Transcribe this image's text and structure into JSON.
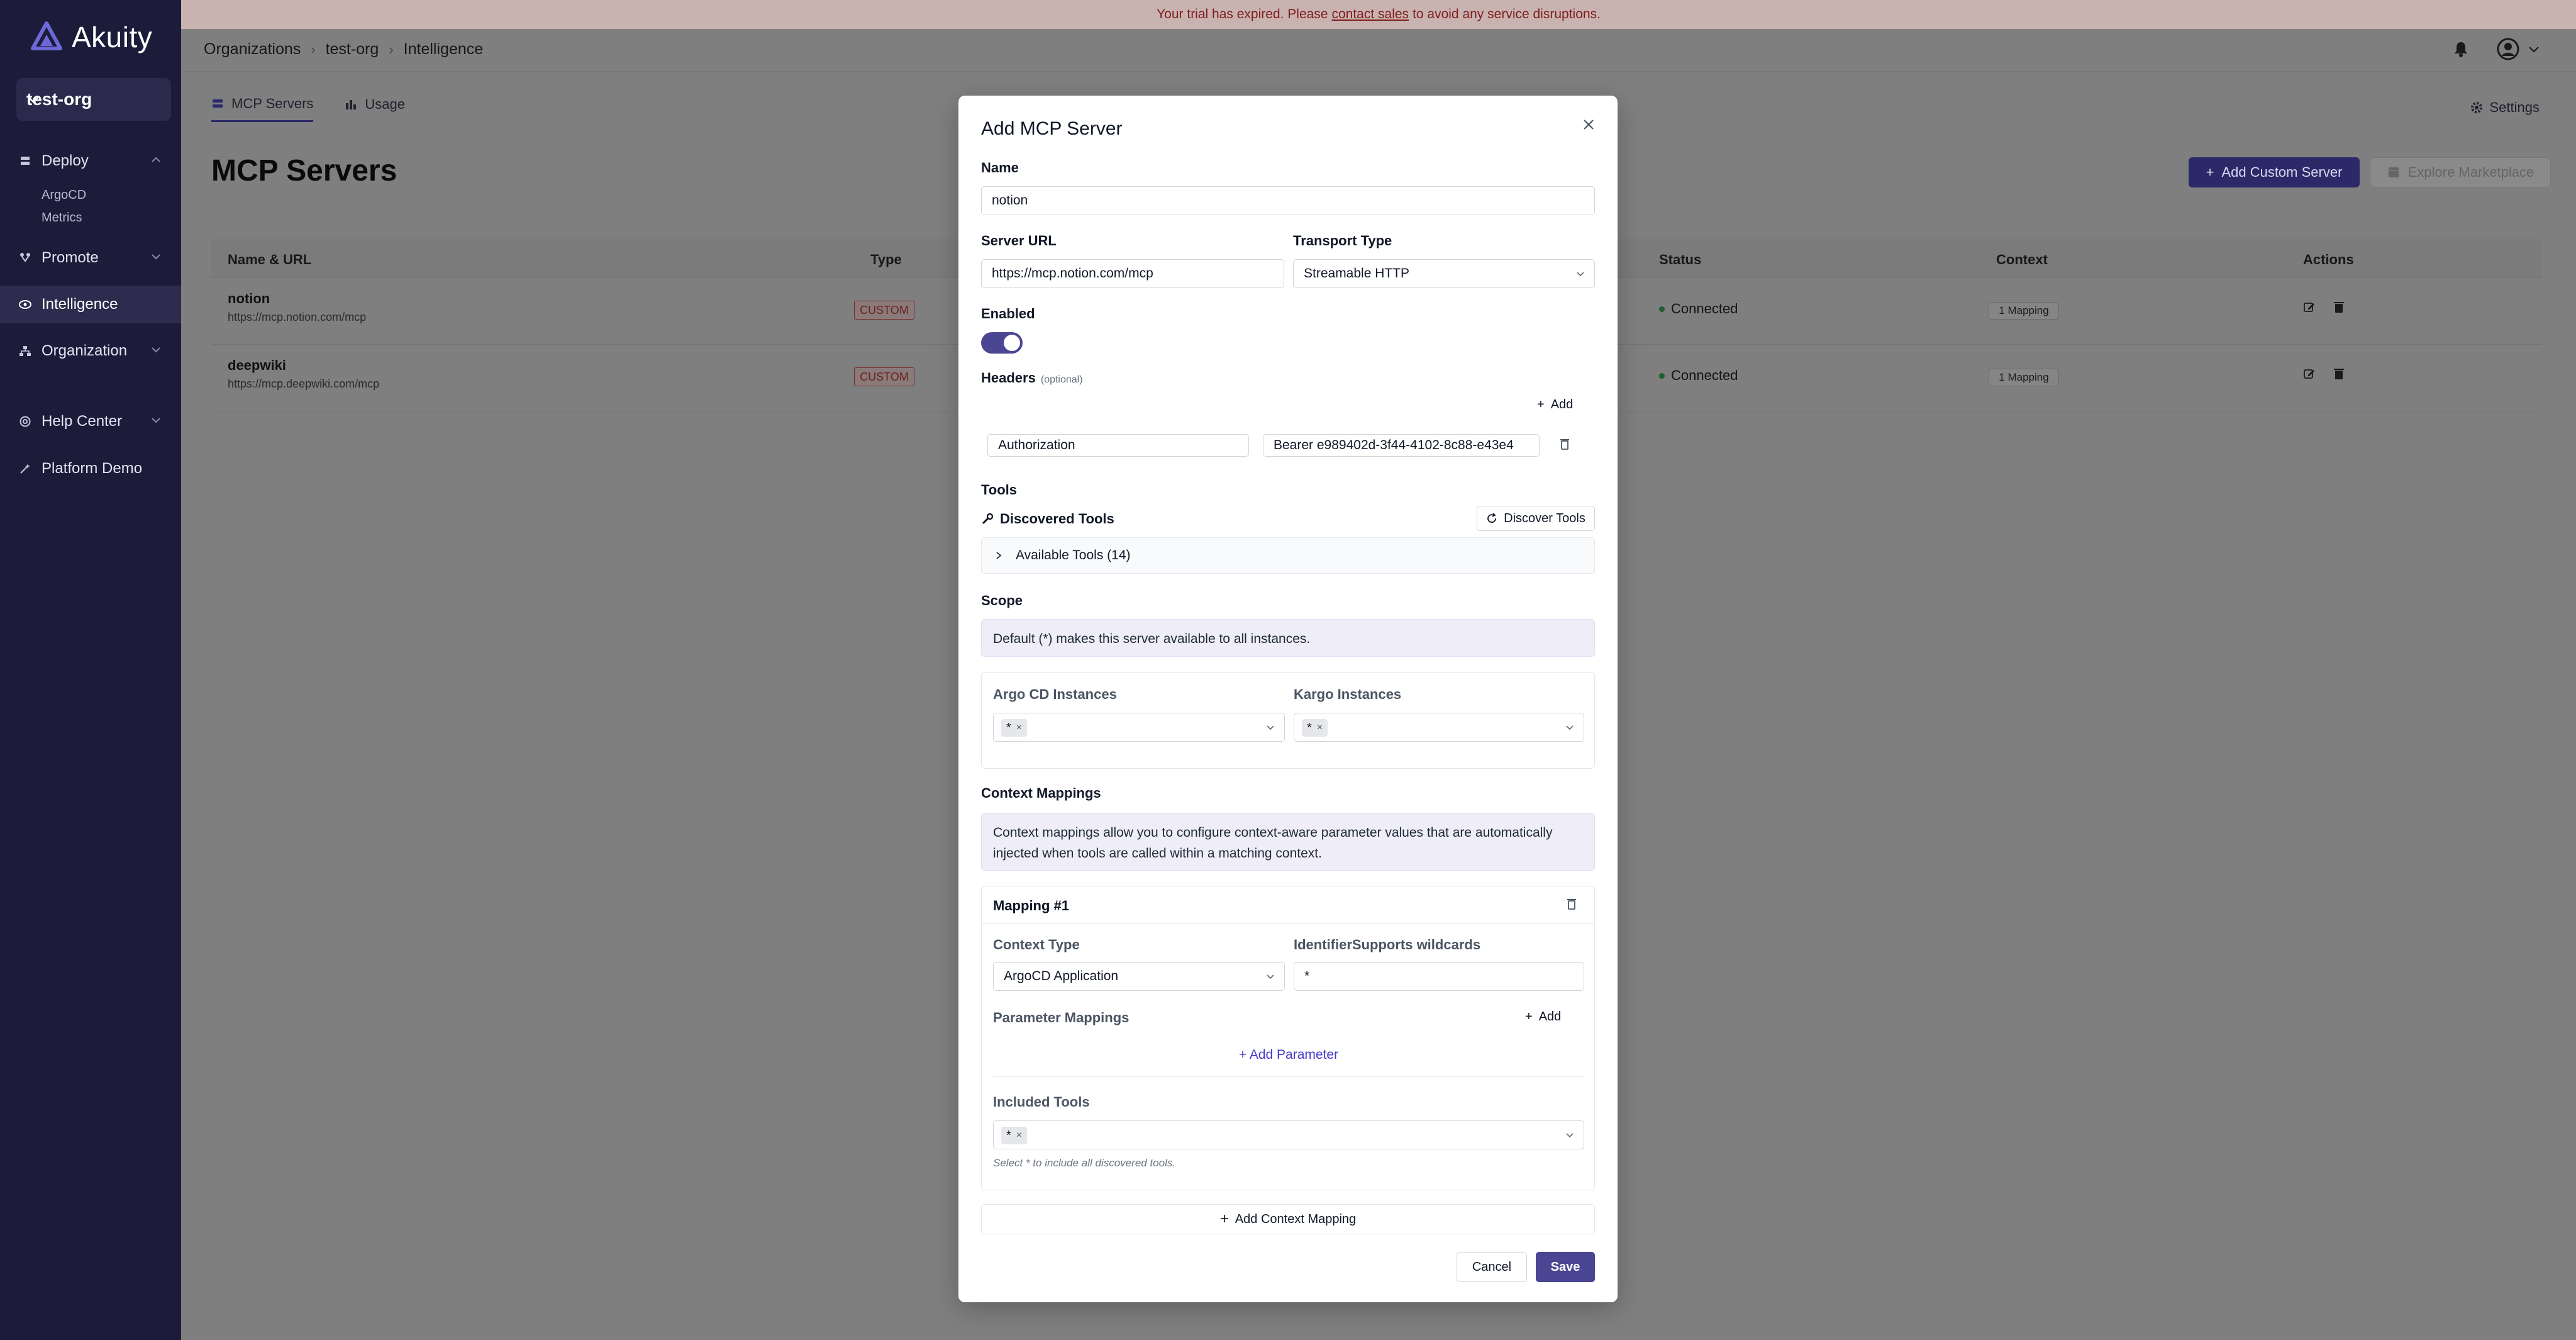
{
  "brand": {
    "name": "Akuity"
  },
  "sidebar": {
    "org": "test-org",
    "items": [
      {
        "label": "Deploy",
        "icon": "layers-icon",
        "expanded": true
      },
      {
        "label": "Promote",
        "icon": "promote-icon",
        "expanded": false
      },
      {
        "label": "Intelligence",
        "icon": "eye-icon",
        "active": true
      },
      {
        "label": "Organization",
        "icon": "organization-icon",
        "expanded": false
      },
      {
        "label": "Help Center",
        "icon": "help-icon",
        "expanded": false
      },
      {
        "label": "Platform Demo",
        "icon": "wand-icon"
      }
    ],
    "deploy_sub": [
      "ArgoCD",
      "Metrics"
    ]
  },
  "banner": {
    "pre": "Your trial has expired. Please",
    "link": "contact sales",
    "post": "to avoid any service disruptions."
  },
  "breadcrumb": [
    "Organizations",
    "test-org",
    "Intelligence"
  ],
  "tabs": [
    {
      "label": "MCP Servers",
      "active": true
    },
    {
      "label": "Usage",
      "active": false
    }
  ],
  "settings_label": "Settings",
  "page_title": "MCP Servers",
  "buttons": {
    "add_custom": "Add Custom Server",
    "explore": "Explore Marketplace"
  },
  "table": {
    "headers": [
      "Name & URL",
      "Type",
      "Status",
      "Context",
      "Actions"
    ],
    "rows": [
      {
        "name": "notion",
        "url": "https://mcp.notion.com/mcp",
        "type": "CUSTOM",
        "status": "Connected",
        "context": "1 Mapping"
      },
      {
        "name": "deepwiki",
        "url": "https://mcp.deepwiki.com/mcp",
        "type": "CUSTOM",
        "status": "Connected",
        "context": "1 Mapping"
      }
    ]
  },
  "modal": {
    "title": "Add MCP Server",
    "name_label": "Name",
    "name_value": "notion",
    "server_url_label": "Server URL",
    "server_url_value": "https://mcp.notion.com/mcp",
    "transport_label": "Transport Type",
    "transport_value": "Streamable HTTP",
    "enabled_label": "Enabled",
    "enabled": true,
    "headers_label": "Headers",
    "headers_optional": "(optional)",
    "add_label": "Add",
    "header_key": "Authorization",
    "header_value": "Bearer e989402d-3f44-4102-8c88-e43e4",
    "tools_label": "Tools",
    "discovered_tools": "Discovered Tools",
    "discover_button": "Discover Tools",
    "available_tools": "Available Tools (14)",
    "scope_label": "Scope",
    "scope_info": "Default (*) makes this server available to all instances.",
    "argo_label": "Argo CD Instances",
    "kargo_label": "Kargo Instances",
    "wildcard": "*",
    "context_mappings_label": "Context Mappings",
    "context_info": "Context mappings allow you to configure context-aware parameter values that are automatically injected when tools are called within a matching context.",
    "mapping_title": "Mapping #1",
    "context_type_label": "Context Type",
    "context_type_value": "ArgoCD Application",
    "identifier_label": "Identifier",
    "identifier_hint": "Supports wildcards",
    "identifier_value": "*",
    "param_mappings_label": "Parameter Mappings",
    "add_parameter": "+ Add Parameter",
    "included_tools_label": "Included Tools",
    "included_help": "Select * to include all discovered tools.",
    "add_context_mapping": "Add Context Mapping",
    "cancel": "Cancel",
    "save": "Save"
  },
  "colors": {
    "sidebar_bg": "#1c1b3a",
    "primary": "#4a4694",
    "banner_text": "#7f1d1d",
    "connected": "#22c55e",
    "overlay": "#7f7f7f"
  }
}
